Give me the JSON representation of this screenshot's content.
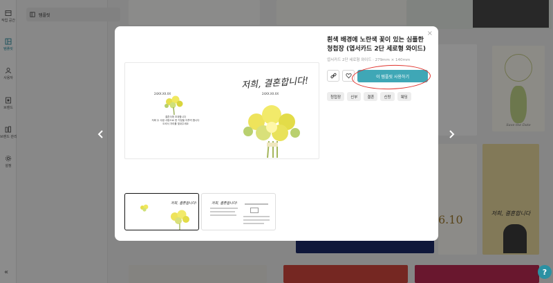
{
  "rail": {
    "items": [
      {
        "label": "작업 공간",
        "icon": "box-icon"
      },
      {
        "label": "템플릿",
        "icon": "template-icon",
        "active": true
      },
      {
        "label": "사용자",
        "icon": "user-icon"
      },
      {
        "label": "브랜드",
        "icon": "brand-icon"
      },
      {
        "label": "브랜드 관리",
        "icon": "brand-manage-icon"
      },
      {
        "label": "설정",
        "icon": "gear-icon"
      }
    ],
    "collapse": "«"
  },
  "sidebar": {
    "item_label": "템플릿"
  },
  "modal": {
    "title": "흰색 배경에 노란색 꽃이 있는 심플한 청첩장 (엽서카드 2단 세로형 와이드)",
    "subtitle": "엽서카드 2단 세로형 와이드 · 279mm × 140mm",
    "use_button": "이 템플릿 사용하기",
    "tags": [
      "청첩장",
      "신부",
      "결혼",
      "신랑",
      "웨딩"
    ],
    "close": "×"
  },
  "preview": {
    "date_left": "24XX.XX.XX",
    "script": "저희, 결혼합니다!",
    "date_right": "24XX.XX.XX",
    "lines": [
      "결혼식에 초대합니다",
      "저희 두 사람 사랑으로 한 가정을 이루려 합니다",
      "오셔서 자리를 빛내주세요"
    ],
    "thumb_script": "저희, 결혼합니다!"
  },
  "gallery": {
    "date_number": "6.10",
    "script": "저희, 결혼합니다",
    "card_title": "Save the Date"
  },
  "help": "?",
  "colors": {
    "accent": "#3fa7b6",
    "annotation": "#e0332d",
    "overlay": "rgba(0,0,0,0.45)"
  }
}
